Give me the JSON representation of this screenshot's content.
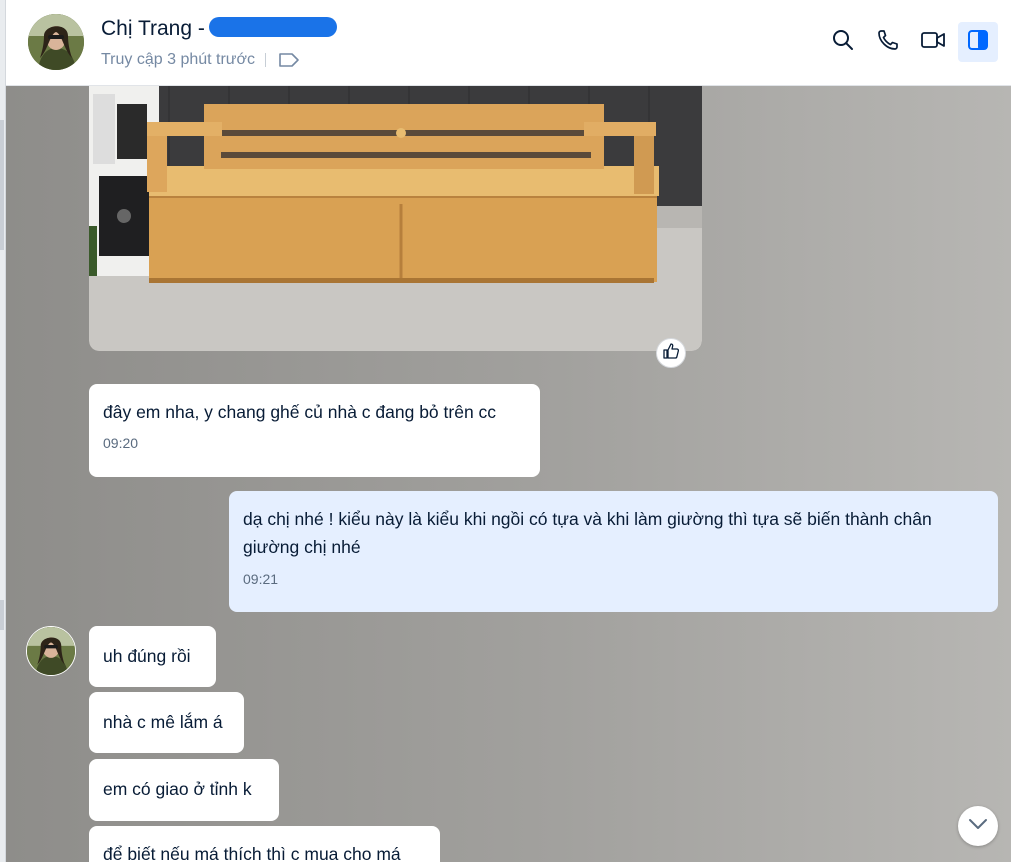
{
  "header": {
    "contact_name": "Chị Trang -",
    "status": "Truy cập 3 phút trước"
  },
  "icons": {
    "search": "search-icon",
    "call": "phone-icon",
    "video": "video-icon",
    "panel": "sidebar-panel-icon",
    "tag": "tag-icon",
    "like": "thumbs-up-icon",
    "scroll": "chevron-down-icon"
  },
  "colors": {
    "accent": "#1a73e8",
    "own_bubble": "#e5efff",
    "other_bubble": "#ffffff",
    "text": "#081c36"
  },
  "messages": [
    {
      "from": "contact",
      "text": "đây em nha, y chang ghế củ nhà c đang bỏ trên cc",
      "time": "09:20"
    },
    {
      "from": "me",
      "text": "dạ chị nhé ! kiểu này là kiểu khi ngồi có tựa và khi làm giường thì tựa sẽ biến thành chân giường chị nhé",
      "time": "09:21"
    },
    {
      "from": "contact",
      "text": "uh đúng rồi"
    },
    {
      "from": "contact",
      "text": "nhà c mê lắm á"
    },
    {
      "from": "contact",
      "text": "em có giao ở tỉnh k"
    },
    {
      "from": "contact",
      "text": "để biết nếu má thích thì c mua cho má"
    }
  ]
}
